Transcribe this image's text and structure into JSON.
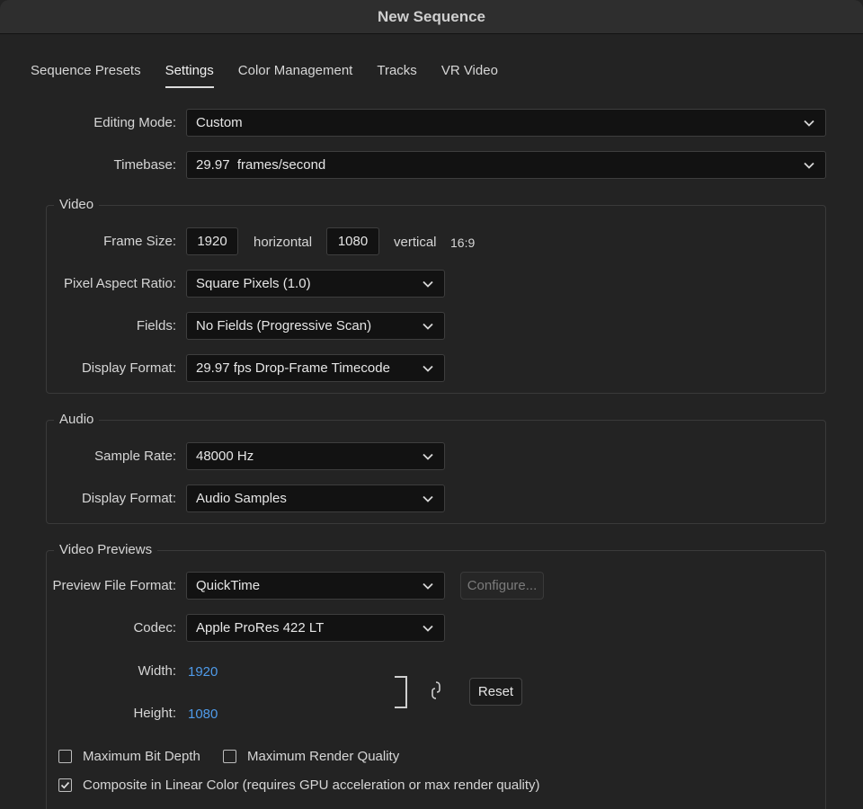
{
  "window": {
    "title": "New Sequence"
  },
  "tabs": [
    {
      "label": "Sequence Presets"
    },
    {
      "label": "Settings"
    },
    {
      "label": "Color Management"
    },
    {
      "label": "Tracks"
    },
    {
      "label": "VR Video"
    }
  ],
  "active_tab": "Settings",
  "general": {
    "editing_mode": {
      "label": "Editing Mode:",
      "value": "Custom"
    },
    "timebase": {
      "label": "Timebase:",
      "value": "29.97  frames/second"
    }
  },
  "video": {
    "title": "Video",
    "frame_size": {
      "label": "Frame Size:",
      "horizontal": "1920",
      "horizontal_label": "horizontal",
      "vertical": "1080",
      "vertical_label": "vertical",
      "aspect": "16:9"
    },
    "pixel_aspect_ratio": {
      "label": "Pixel Aspect Ratio:",
      "value": "Square Pixels (1.0)"
    },
    "fields": {
      "label": "Fields:",
      "value": "No Fields (Progressive Scan)"
    },
    "display_format": {
      "label": "Display Format:",
      "value": "29.97 fps Drop-Frame Timecode"
    }
  },
  "audio": {
    "title": "Audio",
    "sample_rate": {
      "label": "Sample Rate:",
      "value": "48000 Hz"
    },
    "display_format": {
      "label": "Display Format:",
      "value": "Audio Samples"
    }
  },
  "video_previews": {
    "title": "Video Previews",
    "preview_file_format": {
      "label": "Preview File Format:",
      "value": "QuickTime"
    },
    "configure_label": "Configure...",
    "codec": {
      "label": "Codec:",
      "value": "Apple ProRes 422 LT"
    },
    "width": {
      "label": "Width:",
      "value": "1920"
    },
    "height": {
      "label": "Height:",
      "value": "1080"
    },
    "reset_label": "Reset",
    "max_bit_depth": {
      "label": "Maximum Bit Depth",
      "checked": false
    },
    "max_render_quality": {
      "label": "Maximum Render Quality",
      "checked": false
    },
    "composite_linear": {
      "label": "Composite in Linear Color (requires GPU acceleration or max render quality)",
      "checked": true
    }
  },
  "icons": {
    "dropdown": "chevron-down-icon",
    "link": "chain-link-icon",
    "check": "checkmark-icon"
  }
}
